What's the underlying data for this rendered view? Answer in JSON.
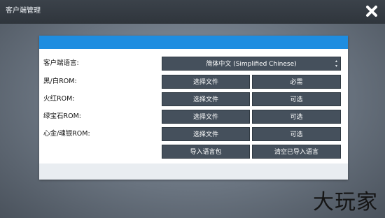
{
  "window": {
    "title": "客户端管理",
    "close_icon": "close-icon"
  },
  "rows": [
    {
      "label": "客户端语言:",
      "control": "select",
      "value": "简体中文 (Simplified Chinese)"
    },
    {
      "label": "黑/白ROM:",
      "file_button": "选择文件",
      "status": "必需"
    },
    {
      "label": "火红ROM:",
      "file_button": "选择文件",
      "status": "可选"
    },
    {
      "label": "绿宝石ROM:",
      "file_button": "选择文件",
      "status": "可选"
    },
    {
      "label": "心金/魂银ROM:",
      "file_button": "选择文件",
      "status": "可选"
    }
  ],
  "actions": {
    "import_language": "导入语言包",
    "clear_imported": "清空已导入语言"
  },
  "watermark": "大玩家"
}
